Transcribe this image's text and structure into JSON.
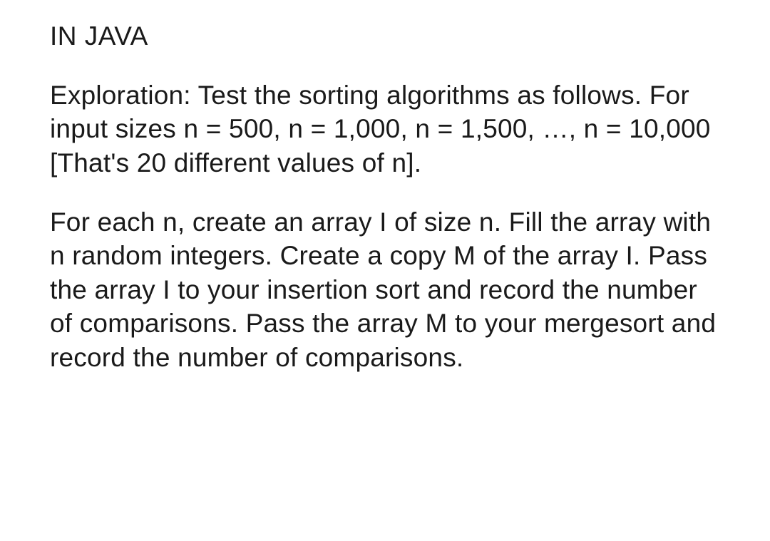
{
  "heading": "IN JAVA",
  "paragraph1": "Exploration: Test the sorting algorithms as follows. For input sizes n = 500, n = 1,000, n = 1,500, …, n = 10,000 [That's 20 different values of n].",
  "paragraph2": "For each n, create an array I of size n. Fill the array with n random integers. Create a copy M of the array I. Pass the array I to your insertion sort and record the number of comparisons. Pass the array M to your mergesort and record the number of comparisons."
}
